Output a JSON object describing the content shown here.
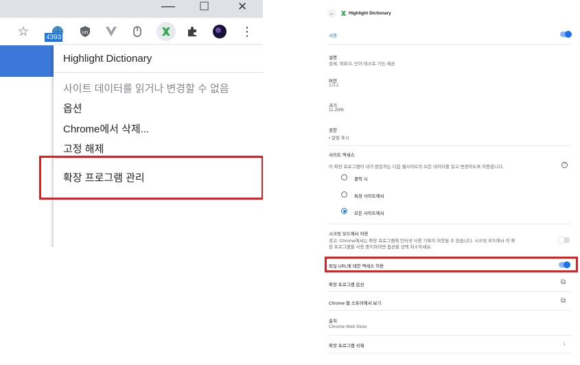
{
  "colors": {
    "accent": "#1a73e8",
    "highlight": "#e02020"
  },
  "browser": {
    "window_controls": [
      "—",
      "☐",
      "✕"
    ],
    "toolbar_badge": "4393",
    "menu": {
      "title": "Highlight Dictionary",
      "items": [
        "사이트 데이터를 읽거나 변경할 수 없음",
        "옵션",
        "Chrome에서 삭제...",
        "고정 해제"
      ],
      "manage": "확장 프로그램 관리"
    }
  },
  "details": {
    "header_title": "Highlight Dictionary",
    "on_label": "사용",
    "description_label": "설명",
    "description_value": "검색, 북마크, 단어 테스트 기능 제공",
    "version_label": "버전",
    "version_value": "1.0.1",
    "size_label": "크기",
    "size_value": "11.2MB",
    "permissions_label": "권한",
    "permissions_value": "• 알림 표시",
    "site_access_label": "사이트 액세스",
    "site_access_desc": "이 확장 프로그램이 내가 방문하는 다음 웹사이트의 모든 데이터를 읽고 변경하도록 허용합니다.",
    "site_access_options": [
      "클릭 시",
      "특정 사이트에서",
      "모든 사이트에서"
    ],
    "site_access_selected": "모든 사이트에서",
    "incognito_label": "시크릿 모드에서 허용",
    "incognito_warning_line1": "경고: Chrome에서는 확장 프로그램에 인터넷 사용 기록이 저장될 수 있습니다. 시크릿 모드에서 이 확",
    "incognito_warning_line2": "장 프로그램을 사용 중지하려면 옵션을 선택 취소하세요.",
    "file_url_label": "파일 URL에 대한 액세스 허용",
    "options_label": "확장 프로그램 옵션",
    "web_store_label": "Chrome 웹 스토어에서 보기",
    "source_label": "출처",
    "source_value": "Chrome Web Store",
    "remove_label": "확장 프로그램 삭제",
    "toggles": {
      "enabled": true,
      "incognito": false,
      "file_url": true
    }
  }
}
